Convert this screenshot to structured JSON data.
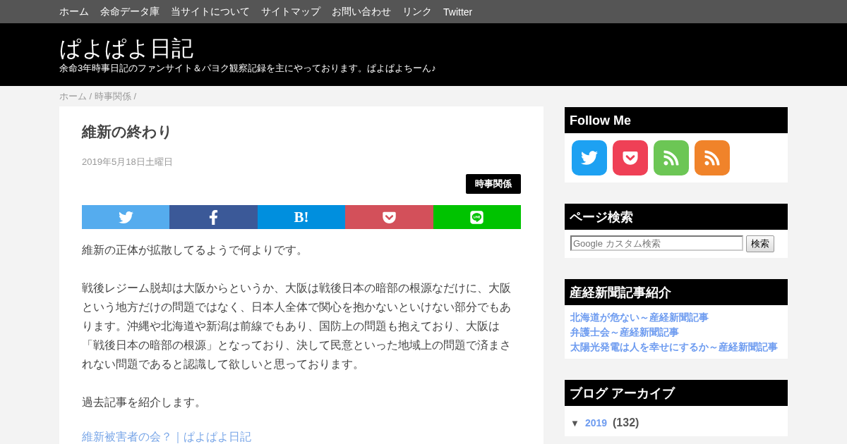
{
  "nav": {
    "items": [
      "ホーム",
      "余命データ庫",
      "当サイトについて",
      "サイトマップ",
      "お問い合わせ",
      "リンク",
      "Twitter"
    ]
  },
  "header": {
    "title": "ぱよぱよ日記",
    "tagline": "余命3年時事日記のファンサイト＆パヨク観察記録を主にやっております。ぱよぱよちーん♪"
  },
  "breadcrumb": "ホーム / 時事関係 /",
  "article": {
    "title": "維新の終わり",
    "date": "2019年5月18日土曜日",
    "category": "時事関係",
    "share": [
      {
        "kind": "twitter",
        "color": "#55acee"
      },
      {
        "kind": "facebook",
        "color": "#3b5998"
      },
      {
        "kind": "hatena",
        "color": "#008fde",
        "label": "B!"
      },
      {
        "kind": "pocket",
        "color": "#d3505a"
      },
      {
        "kind": "line",
        "color": "#00c300"
      }
    ],
    "paragraphs": [
      "維新の正体が拡散してるようで何よりです。",
      "戦後レジーム脱却は大阪からというか、大阪は戦後日本の暗部の根源なだけに、大阪という地方だけの問題ではなく、日本人全体で関心を抱かないといけない部分でもあります。沖縄や北海道や新潟は前線でもあり、国防上の問題も抱えており、大阪は「戦後日本の暗部の根源」となっており、決して民意といった地域上の問題で済まされない問題であると認識して欲しいと思っております。",
      "過去記事を紹介します。"
    ],
    "link": "維新被害者の会？｜ぱよぱよ日記"
  },
  "sidebar": {
    "follow": {
      "title": "Follow Me",
      "icons": [
        {
          "kind": "twitter",
          "color": "#1da1f2"
        },
        {
          "kind": "pocket",
          "color": "#ef4056"
        },
        {
          "kind": "rss",
          "color": "#6cc655"
        },
        {
          "kind": "rss",
          "color": "#f0832a"
        }
      ]
    },
    "search": {
      "title": "ページ検索",
      "placeholder": "Google カスタム検索",
      "button": "検索"
    },
    "sankei": {
      "title": "産経新聞記事紹介",
      "links": [
        "北海道が危ない～産経新聞記事",
        "弁護士会～産経新聞記事",
        "太陽光発電は人を幸せにするか～産経新聞記事"
      ]
    },
    "archive": {
      "title": "ブログ アーカイブ",
      "toggle": "▼",
      "year": "2019",
      "count": "(132)"
    }
  }
}
